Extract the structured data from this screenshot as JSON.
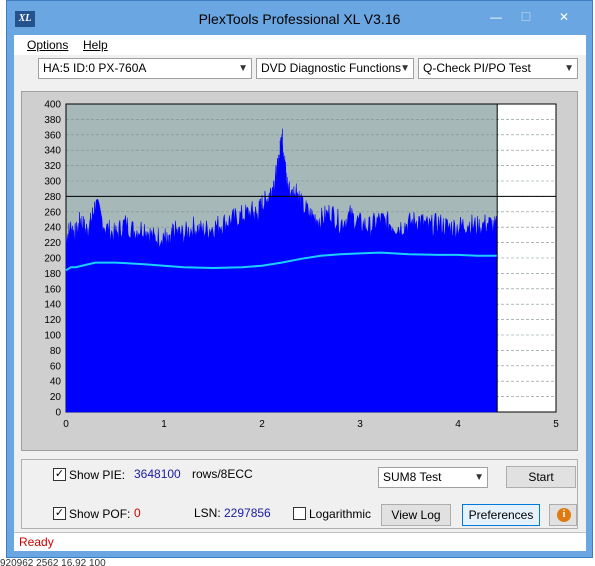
{
  "window": {
    "title": "PlexTools Professional XL V3.16",
    "icon_text": "XL",
    "min_symbol": "—",
    "max_symbol": "☐",
    "close_symbol": "✕"
  },
  "menu": {
    "options": "Options",
    "help": "Help"
  },
  "toolbar": {
    "drive": "HA:5 ID:0  PX-760A",
    "function": "DVD Diagnostic Functions",
    "test": "Q-Check PI/PO Test"
  },
  "chart_data": {
    "type": "area",
    "title": "",
    "xlabel": "",
    "ylabel": "",
    "xlim": [
      0,
      5
    ],
    "ylim": [
      0,
      400
    ],
    "x_ticks": [
      "0",
      "1",
      "2",
      "3",
      "4",
      "5"
    ],
    "y_ticks": [
      "0",
      "20",
      "40",
      "60",
      "80",
      "100",
      "120",
      "140",
      "160",
      "180",
      "200",
      "220",
      "240",
      "260",
      "280",
      "300",
      "320",
      "340",
      "360",
      "380",
      "400"
    ],
    "threshold_line": 280,
    "data_end_x": 4.4,
    "cursor_x": 4.4,
    "grid": true,
    "colors": {
      "pie_fill": "#0000ff",
      "sum_line": "#19d0ff",
      "plot_bg": "#a6b8b8",
      "empty_bg": "#ffffff"
    },
    "series": [
      {
        "name": "PIE",
        "x": [
          0,
          0.05,
          0.1,
          0.15,
          0.2,
          0.25,
          0.3,
          0.4,
          0.5,
          0.6,
          0.7,
          0.8,
          0.9,
          1.0,
          1.05,
          1.1,
          1.2,
          1.3,
          1.4,
          1.5,
          1.6,
          1.7,
          1.8,
          1.9,
          1.95,
          2.0,
          2.05,
          2.1,
          2.15,
          2.18,
          2.2,
          2.22,
          2.25,
          2.3,
          2.35,
          2.4,
          2.5,
          2.6,
          2.7,
          2.8,
          2.9,
          3.0,
          3.1,
          3.2,
          3.3,
          3.4,
          3.5,
          3.6,
          3.7,
          3.8,
          3.9,
          4.0,
          4.1,
          4.2,
          4.3,
          4.4
        ],
        "y": [
          225,
          240,
          230,
          250,
          235,
          245,
          270,
          240,
          230,
          245,
          235,
          240,
          225,
          230,
          215,
          235,
          230,
          240,
          235,
          240,
          245,
          250,
          255,
          260,
          255,
          270,
          275,
          290,
          310,
          330,
          365,
          340,
          300,
          280,
          290,
          270,
          255,
          250,
          260,
          245,
          255,
          245,
          240,
          250,
          245,
          240,
          245,
          250,
          240,
          245,
          240,
          240,
          245,
          240,
          245,
          240
        ]
      },
      {
        "name": "SUM8",
        "x": [
          0,
          0.05,
          0.1,
          0.2,
          0.3,
          0.5,
          0.8,
          1.0,
          1.2,
          1.5,
          1.8,
          2.0,
          2.2,
          2.4,
          2.6,
          2.8,
          3.0,
          3.2,
          3.5,
          3.8,
          4.0,
          4.2,
          4.4
        ],
        "y": [
          184,
          188,
          188,
          191,
          194,
          194,
          192,
          190,
          188,
          187,
          188,
          190,
          194,
          199,
          203,
          205,
          206,
          207,
          205,
          204,
          204,
          203,
          203
        ]
      }
    ]
  },
  "controls": {
    "show_pie_label": "Show PIE:",
    "show_pie_checked": "✓",
    "pie_value": "3648100",
    "pie_unit": "rows/8ECC",
    "show_poe_label": "Show POF:",
    "show_poe_checked": "✓",
    "poe_value": "0",
    "lsn_label": "LSN:",
    "lsn_value": "2297856",
    "log_label": "Logarithmic",
    "sum_select": "SUM8 Test",
    "start_button": "Start",
    "viewlog_button": "View Log",
    "pref_button": "Preferences",
    "info_icon": "i"
  },
  "status": {
    "text": "Ready"
  },
  "background": {
    "strip_text": "920962      2562      16.92                                                                                                         100"
  }
}
